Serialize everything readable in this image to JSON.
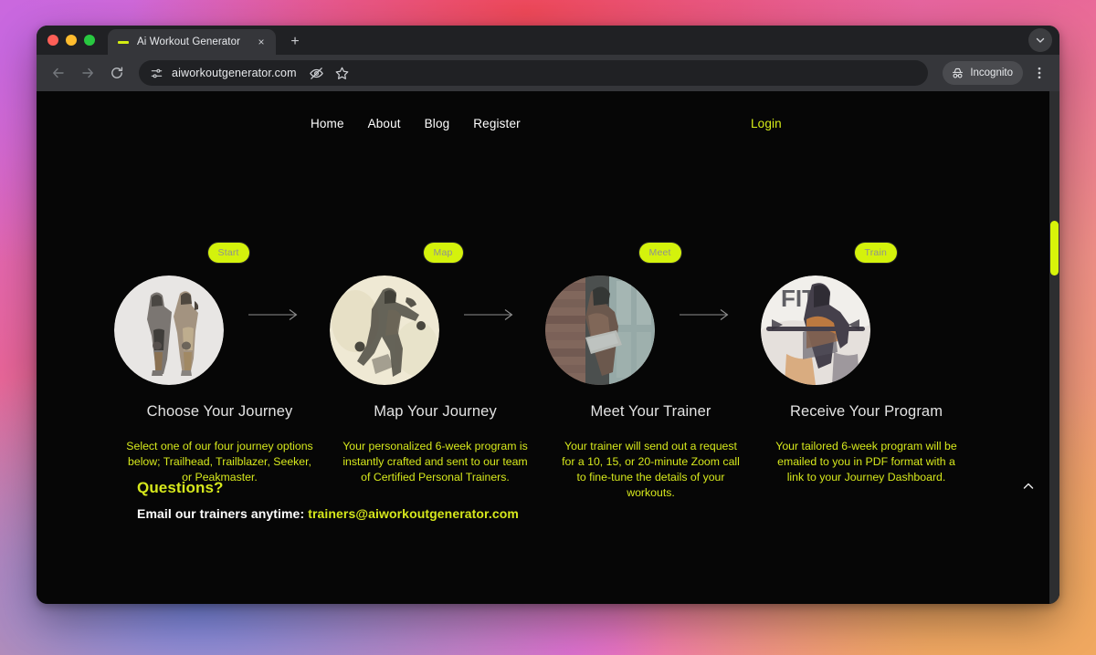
{
  "browser": {
    "tab": {
      "title": "Ai Workout Generator",
      "favicon": "dash-icon",
      "close_label": "×"
    },
    "new_tab_label": "+",
    "toolbar": {
      "back": "back-arrow-icon",
      "forward": "forward-arrow-icon",
      "reload": "reload-icon",
      "site_info": "tune-icon",
      "url": "aiworkoutgenerator.com",
      "hide_password": "eye-slash-icon",
      "bookmark": "star-icon",
      "incognito_label": "Incognito",
      "menu": "kebab-menu-icon",
      "tabstrip_chevron": "chevron-down-icon"
    },
    "traffic_lights": {
      "close_color": "#ff5f57",
      "minimize_color": "#febc2e",
      "maximize_color": "#28c840"
    }
  },
  "site": {
    "nav": {
      "links": [
        {
          "label": "Home"
        },
        {
          "label": "About"
        },
        {
          "label": "Blog"
        },
        {
          "label": "Register"
        }
      ],
      "login_label": "Login"
    },
    "steps": [
      {
        "badge": "Start",
        "title": "Choose Your Journey",
        "desc": "Select one of our four journey options below; Trailhead, Trailblazer, Seeker, or Peakmaster.",
        "image_alt": "two-people-walking-with-dumbbells-photo"
      },
      {
        "badge": "Map",
        "title": "Map Your Journey",
        "desc": "Your personalized 6-week program is instantly crafted and sent to our team of Certified Personal Trainers.",
        "image_alt": "runner-double-exposure-photo"
      },
      {
        "badge": "Meet",
        "title": "Meet Your Trainer",
        "desc": "Your trainer will send out a request for a 10, 15, or 20-minute Zoom call to fine-tune the details of your workouts.",
        "image_alt": "trainer-reading-notes-by-brick-wall-photo"
      },
      {
        "badge": "Train",
        "title": "Receive Your Program",
        "desc": "Your tailored 6-week program will be emailed to you in PDF format with a link to your Journey Dashboard.",
        "image_alt": "athlete-with-barbell-fit-photo"
      }
    ],
    "questions": {
      "title": "Questions?",
      "prefix": "Email our trainers anytime: ",
      "email": "trainers@aiworkoutgenerator.com"
    },
    "scroll_top_icon": "chevron-up-icon",
    "colors": {
      "accent_yellow": "#d6e81c",
      "badge_yellow": "#d4f20c",
      "page_background": "#060606",
      "heading_gray": "#e2e2e2"
    }
  }
}
